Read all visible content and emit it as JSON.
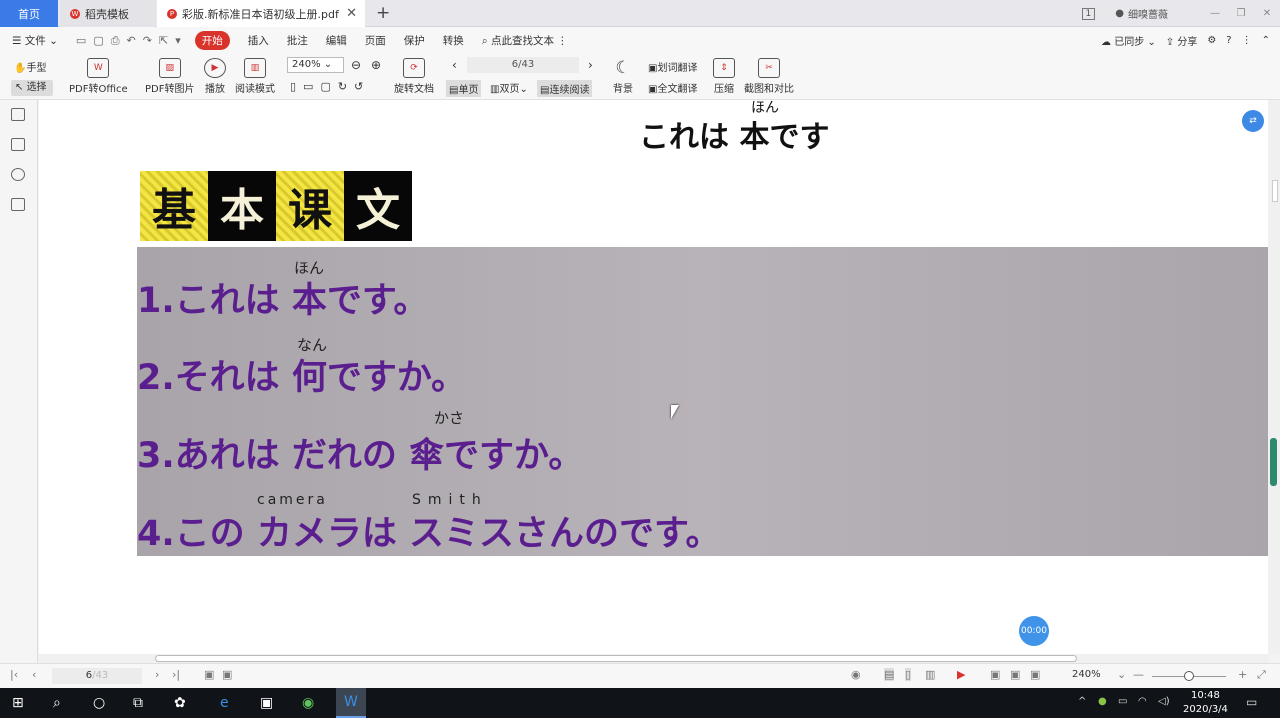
{
  "titlebar": {
    "home_tab": "首页",
    "tab1": "稻壳模板",
    "tab2": "彩版.新标准日本语初级上册.pdf",
    "account_badge": "1",
    "account_name": "细嗅蔷薇"
  },
  "menu": {
    "file": "文件",
    "items": [
      "开始",
      "插入",
      "批注",
      "编辑",
      "页面",
      "保护",
      "转换"
    ],
    "search": "点此查找文本",
    "sync": "已同步",
    "share": "分享"
  },
  "toolbar": {
    "hand": "手型",
    "select": "选择",
    "pdf_office": "PDF转Office",
    "pdf_image": "PDF转图片",
    "play": "播放",
    "read_mode": "阅读模式",
    "zoom": "240%",
    "rotate": "旋转文档",
    "page_indicator": "6/43",
    "single": "单页",
    "double": "双页",
    "continuous": "连续阅读",
    "background": "背景",
    "word_translate": "划词翻译",
    "full_translate": "全文翻译",
    "compress": "压缩",
    "screenshot": "截图和对比"
  },
  "document": {
    "heading": "これは 本です",
    "heading_ruby": "ほん",
    "badge": [
      "基",
      "本",
      "课",
      "文"
    ],
    "lines": [
      {
        "text": "1.これは 本です。",
        "ruby": "ほん"
      },
      {
        "text": "2.それは 何ですか。",
        "ruby": "なん"
      },
      {
        "text": "3.あれは だれの 傘ですか。",
        "ruby": "かさ"
      },
      {
        "text": "4.この カメラは スミスさんのです。",
        "ruby": "camera",
        "ruby2": "Smith"
      }
    ],
    "timer": "00:00"
  },
  "statusbar": {
    "page": "6",
    "page_total": "/43",
    "zoom": "240%"
  },
  "taskbar": {
    "time": "10:48",
    "date": "2020/3/4"
  }
}
